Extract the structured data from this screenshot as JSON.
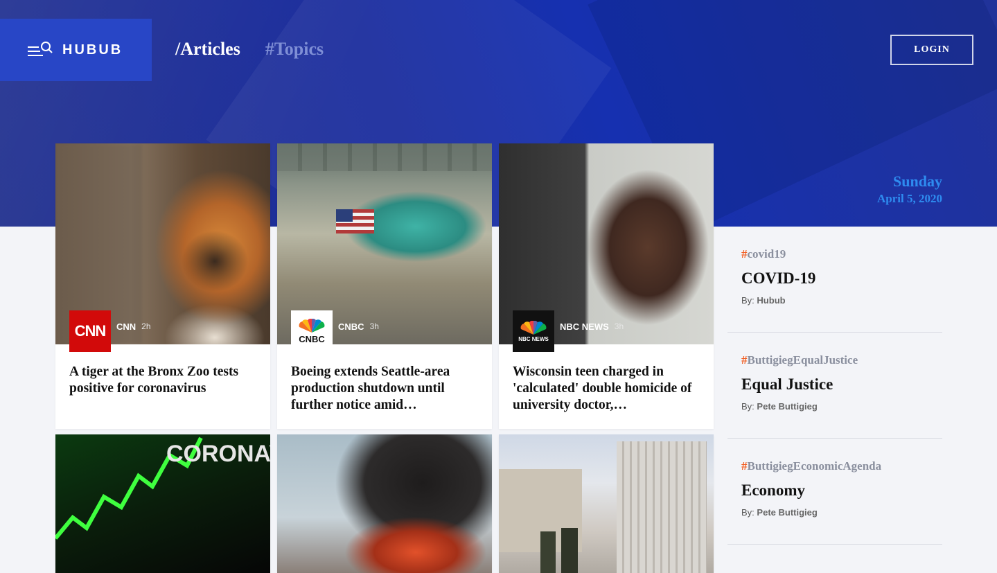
{
  "header": {
    "logo_text": "HUBUB",
    "nav": [
      {
        "label": "/Articles",
        "active": true
      },
      {
        "label": "#Topics",
        "active": false
      }
    ],
    "login_label": "LOGIN"
  },
  "date": {
    "day": "Sunday",
    "full": "April 5, 2020"
  },
  "articles": [
    {
      "source": "CNN",
      "logo_text": "CNN",
      "logo_bg": "#d20a0a",
      "time": "2h",
      "title": "A tiger at the Bronx Zoo tests positive for coronavirus"
    },
    {
      "source": "CNBC",
      "logo_text": "CNBC",
      "logo_bg": "#ffffff",
      "time": "3h",
      "title": "Boeing extends Seattle-area production shutdown until further notice amid…"
    },
    {
      "source": "NBC NEWS",
      "logo_text": "NBC NEWS",
      "logo_bg": "#111111",
      "time": "3h",
      "title": "Wisconsin teen charged in 'calculated' double homicide of university doctor,…"
    },
    {
      "source": "",
      "logo_text": "",
      "time": "",
      "title": ""
    },
    {
      "source": "",
      "logo_text": "",
      "time": "",
      "title": ""
    },
    {
      "source": "",
      "logo_text": "",
      "time": "",
      "title": ""
    }
  ],
  "image_text": {
    "coronavirus_banner": "CORONAVI (COV"
  },
  "topics": [
    {
      "tag": "covid19",
      "name": "COVID-19",
      "by_label": "By:",
      "author": "Hubub"
    },
    {
      "tag": "ButtigiegEqualJustice",
      "name": "Equal Justice",
      "by_label": "By:",
      "author": "Pete Buttigieg"
    },
    {
      "tag": "ButtigiegEconomicAgenda",
      "name": "Economy",
      "by_label": "By:",
      "author": "Pete Buttigieg"
    }
  ],
  "colors": {
    "brand_blue": "#2846c6",
    "hero_blue": "#1b2d9e",
    "date_blue": "#2e8cf0",
    "hash_orange": "#f25a1d"
  }
}
